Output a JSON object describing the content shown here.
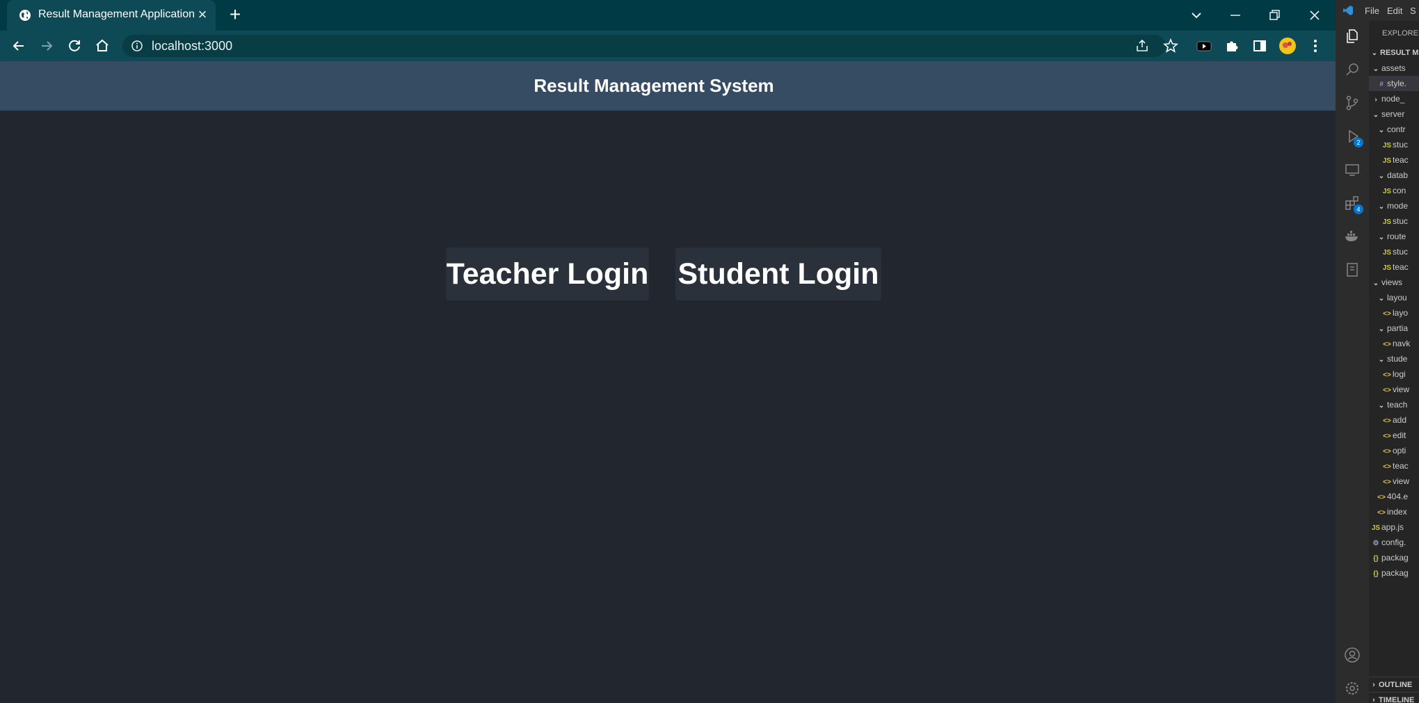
{
  "browser": {
    "tab_title": "Result Management Application",
    "url": "localhost:3000"
  },
  "page": {
    "title": "Result Management System",
    "teacher_login_label": "Teacher Login",
    "student_login_label": "Student Login"
  },
  "vscode": {
    "menu": [
      "File",
      "Edit",
      "S"
    ],
    "explorer_label": "EXPLORER",
    "project_label": "RESULT M",
    "run_badge": "2",
    "extensions_badge": "4",
    "tree": [
      {
        "label": "assets",
        "type": "folder-open",
        "level": 1
      },
      {
        "label": "style.",
        "type": "css",
        "level": 2,
        "selected": true
      },
      {
        "label": "node_",
        "type": "folder-closed",
        "level": 1
      },
      {
        "label": "server",
        "type": "folder-open",
        "level": 1
      },
      {
        "label": "contr",
        "type": "folder-open",
        "level": 2
      },
      {
        "label": "stuc",
        "type": "js",
        "level": 3
      },
      {
        "label": "teac",
        "type": "js",
        "level": 3
      },
      {
        "label": "datab",
        "type": "folder-open",
        "level": 2
      },
      {
        "label": "con",
        "type": "js",
        "level": 3
      },
      {
        "label": "mode",
        "type": "folder-open",
        "level": 2
      },
      {
        "label": "stuc",
        "type": "js",
        "level": 3
      },
      {
        "label": "route",
        "type": "folder-open",
        "level": 2
      },
      {
        "label": "stuc",
        "type": "js",
        "level": 3
      },
      {
        "label": "teac",
        "type": "js",
        "level": 3
      },
      {
        "label": "views",
        "type": "folder-open",
        "level": 1
      },
      {
        "label": "layou",
        "type": "folder-open",
        "level": 2
      },
      {
        "label": "layo",
        "type": "html",
        "level": 3
      },
      {
        "label": "partia",
        "type": "folder-open",
        "level": 2
      },
      {
        "label": "navk",
        "type": "html",
        "level": 3
      },
      {
        "label": "stude",
        "type": "folder-open",
        "level": 2
      },
      {
        "label": "logi",
        "type": "html",
        "level": 3
      },
      {
        "label": "view",
        "type": "html",
        "level": 3
      },
      {
        "label": "teach",
        "type": "folder-open",
        "level": 2
      },
      {
        "label": "add",
        "type": "html",
        "level": 3
      },
      {
        "label": "edit",
        "type": "html",
        "level": 3
      },
      {
        "label": "opti",
        "type": "html",
        "level": 3
      },
      {
        "label": "teac",
        "type": "html",
        "level": 3
      },
      {
        "label": "view",
        "type": "html",
        "level": 3
      },
      {
        "label": "404.e",
        "type": "html",
        "level": 2
      },
      {
        "label": "index",
        "type": "html",
        "level": 2
      },
      {
        "label": "app.js",
        "type": "js",
        "level": 1
      },
      {
        "label": "config.",
        "type": "gear",
        "level": 1
      },
      {
        "label": "packag",
        "type": "json",
        "level": 1
      },
      {
        "label": "packag",
        "type": "json",
        "level": 1
      }
    ],
    "outline_label": "OUTLINE",
    "timeline_label": "TIMELINE"
  }
}
